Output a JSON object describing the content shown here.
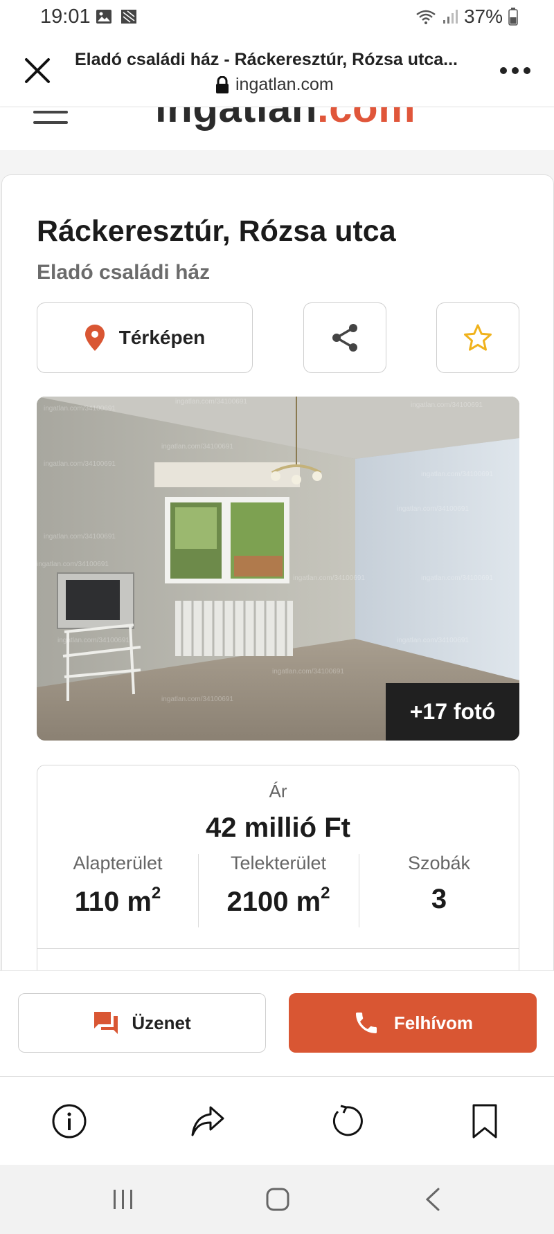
{
  "status_bar": {
    "time": "19:01",
    "battery": "37%",
    "icons": [
      "image-icon",
      "notification-icon",
      "wifi-icon",
      "signal-icon",
      "battery-icon"
    ]
  },
  "browser": {
    "page_title": "Eladó családi ház - Ráckeresztúr, Rózsa utca...",
    "url": "ingatlan.com"
  },
  "site": {
    "logo_main": "ingatlan",
    "logo_accent": ".com",
    "accent_color": "#d95633"
  },
  "listing": {
    "title": "Ráckeresztúr, Rózsa utca",
    "subtitle": "Eladó családi ház",
    "map_button_label": "Térképen",
    "photo_count_label": "+17 fotó",
    "photo_alt": "Empty room with window, radiator and TV stand",
    "watermark": "ingatlan.com/34100691",
    "price_label": "Ár",
    "price_value": "42 millió Ft",
    "stats": [
      {
        "label": "Alapterület",
        "value": "110 m",
        "sup": "2"
      },
      {
        "label": "Telekterület",
        "value": "2100 m",
        "sup": "2"
      },
      {
        "label": "Szobák",
        "value": "3",
        "sup": ""
      }
    ]
  },
  "actions": {
    "message_label": "Üzenet",
    "call_label": "Felhívom"
  }
}
